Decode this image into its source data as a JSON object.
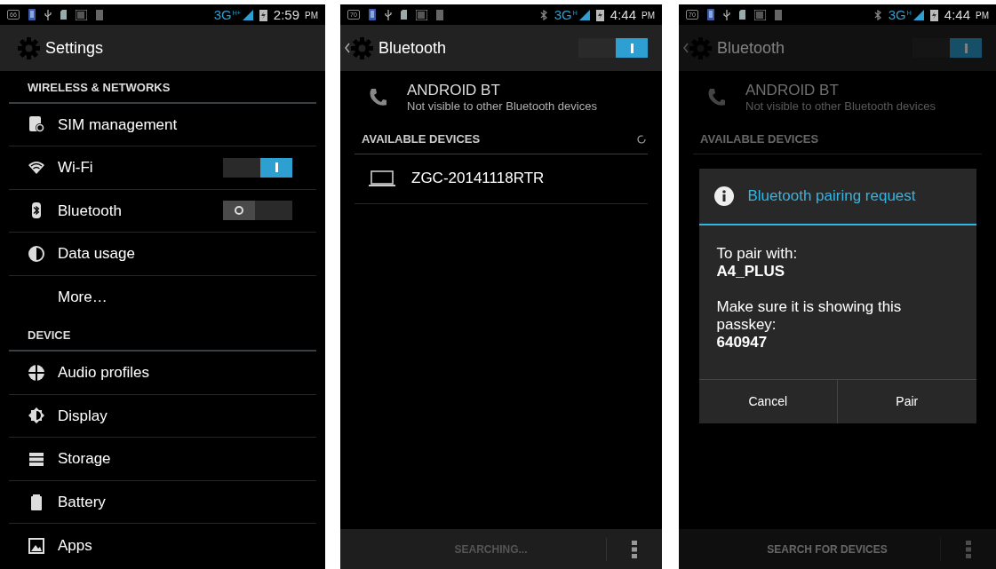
{
  "screens": [
    {
      "kind": "settings",
      "dimmed": false,
      "status_bar": {
        "battery_badge": "66",
        "bluetooth_on": false,
        "network": "3G",
        "network_sub": "H+",
        "time": "2:59",
        "meridiem": "PM"
      },
      "action_bar": {
        "title": "Settings",
        "back": false
      },
      "sections": [
        {
          "header": "WIRELESS & NETWORKS",
          "items": [
            {
              "label": "SIM management"
            },
            {
              "label": "Wi-Fi",
              "on": true
            },
            {
              "label": "Bluetooth",
              "on": false
            },
            {
              "label": "Data usage"
            },
            {
              "label": "More…"
            }
          ]
        },
        {
          "header": "DEVICE",
          "items": [
            {
              "label": "Audio profiles"
            },
            {
              "label": "Display"
            },
            {
              "label": "Storage"
            },
            {
              "label": "Battery"
            },
            {
              "label": "Apps"
            }
          ]
        }
      ]
    },
    {
      "kind": "bluetooth",
      "dimmed": false,
      "status_bar": {
        "battery_badge": "70",
        "bluetooth_on": true,
        "network": "3G",
        "network_sub": "H",
        "time": "4:44",
        "meridiem": "PM"
      },
      "action_bar": {
        "title": "Bluetooth",
        "back": true,
        "on": true
      },
      "this_device": {
        "name": "ANDROID BT",
        "subtitle": "Not visible to other Bluetooth devices"
      },
      "available_header": "AVAILABLE DEVICES",
      "searching": true,
      "devices": [
        "ZGC-20141118RTR"
      ],
      "bottom_bar": {
        "label": "SEARCHING...",
        "disabled": true
      }
    },
    {
      "kind": "bluetooth",
      "dimmed": true,
      "status_bar": {
        "battery_badge": "70",
        "bluetooth_on": true,
        "network": "3G",
        "network_sub": "H",
        "time": "4:44",
        "meridiem": "PM"
      },
      "action_bar": {
        "title": "Bluetooth",
        "back": true,
        "on": true
      },
      "this_device": {
        "name": "ANDROID BT",
        "subtitle": "Not visible to other Bluetooth devices"
      },
      "available_header": "AVAILABLE DEVICES",
      "searching": false,
      "bottom_bar": {
        "label": "SEARCH FOR DEVICES",
        "disabled": false
      },
      "dialog": {
        "title": "Bluetooth pairing request",
        "line_1": "To pair with:",
        "device": "A4_PLUS",
        "line_2": "Make sure it is showing this passkey:",
        "passkey": "640947",
        "buttons": [
          "Cancel",
          "Pair"
        ]
      }
    }
  ]
}
